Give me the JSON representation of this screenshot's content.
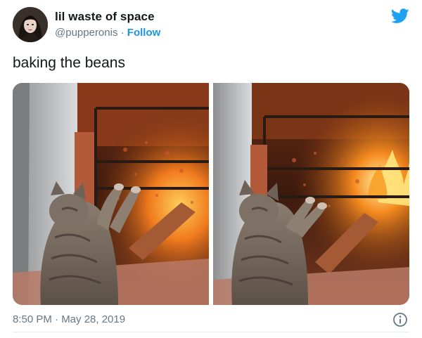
{
  "user": {
    "display_name": "lil waste of space",
    "handle": "@pupperonis",
    "separator": " · ",
    "follow_label": "Follow"
  },
  "tweet": {
    "text": "baking the beans",
    "timestamp": "8:50 PM · May 28, 2019"
  },
  "icons": {
    "brand": "twitter-bird-icon",
    "info": "info-icon"
  },
  "colors": {
    "twitter_blue": "#1da1f2",
    "link": "#1b95e0",
    "secondary_text": "#657786",
    "primary_text": "#14171a"
  }
}
